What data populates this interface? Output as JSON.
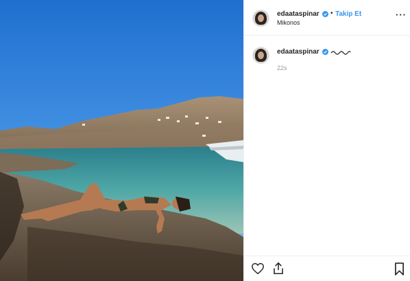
{
  "post": {
    "author": {
      "username": "edaataspinar",
      "verified": true
    },
    "follow_label": "Takip Et",
    "separator": "•",
    "location": "Mikonos",
    "more_icon": "ellipsis-icon",
    "caption": {
      "username": "edaataspinar",
      "text_icon": "wavy-squiggle"
    },
    "timestamp": "22s",
    "actions": {
      "like_icon": "heart-icon",
      "share_icon": "share-icon",
      "save_icon": "bookmark-icon"
    },
    "colors": {
      "link": "#3897f0",
      "verified": "#3897f0",
      "text": "#262626",
      "muted": "#999999",
      "border": "#efefef"
    }
  }
}
